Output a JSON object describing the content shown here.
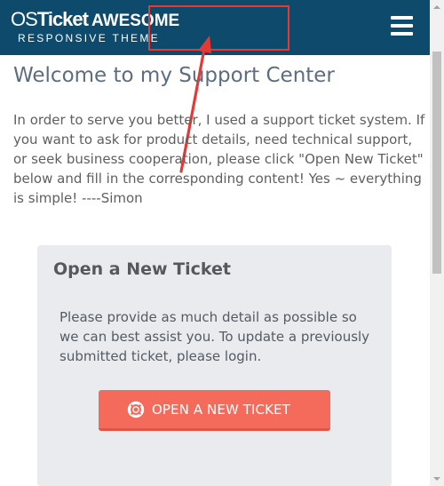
{
  "header": {
    "logo": {
      "os": "OS",
      "ticket": "Ticket",
      "awesome": "AWESOME",
      "tagline": "RESPONSIVE THEME"
    },
    "menu_icon": "hamburger-menu-icon",
    "colors": {
      "background": "#0d4a6b",
      "text": "#ffffff"
    }
  },
  "annotation": {
    "highlight_color": "#e53935",
    "arrow_color": "#e53935"
  },
  "main": {
    "title": "Welcome to my Support Center",
    "intro_lines": [
      "In order to serve you better, I used a support ticket system. If",
      "you want to ask for product details, need technical support,",
      "or seek business cooperation, please click \"Open New Ticket\"",
      "below and fill in the corresponding content! Yes ~ everything",
      "is simple!      ----Simon"
    ]
  },
  "ticket_card": {
    "title": "Open a New Ticket",
    "text_lines": [
      "Please provide as much detail as possible so",
      "we can best assist you. To update a previously",
      "submitted ticket, please login."
    ],
    "button": {
      "label": "OPEN A NEW TICKET",
      "icon": "life-ring-icon",
      "color": "#f46b5c"
    },
    "background": "#e9ebef"
  }
}
